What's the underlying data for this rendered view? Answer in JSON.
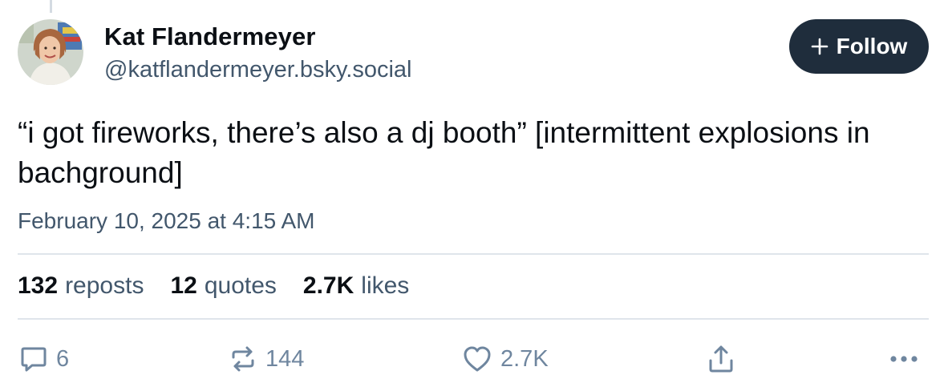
{
  "author": {
    "name": "Kat Flandermeyer",
    "handle": "@katflandermeyer.bsky.social",
    "avatar_alt": "profile photo"
  },
  "follow_button": {
    "icon": "plus-icon",
    "label": "Follow"
  },
  "post": {
    "text": "“i got fireworks, there’s also a dj booth” [intermittent explosions in bachground]",
    "timestamp": "February 10, 2025 at 4:15 AM"
  },
  "stats": [
    {
      "count": "132",
      "label": "reposts"
    },
    {
      "count": "12",
      "label": "quotes"
    },
    {
      "count": "2.7K",
      "label": "likes"
    }
  ],
  "actions": {
    "reply": {
      "icon": "reply-bubble-icon",
      "count": "6"
    },
    "repost": {
      "icon": "repost-icon",
      "count": "144"
    },
    "like": {
      "icon": "heart-icon",
      "count": "2.7K"
    },
    "share": {
      "icon": "share-icon"
    },
    "more": {
      "icon": "more-dots-icon"
    }
  },
  "colors": {
    "primary_text": "#0b0f14",
    "secondary_text": "#42576c",
    "action_icon": "#6f869f",
    "follow_button_bg": "#1f2d3c",
    "divider": "#dfe5eb"
  }
}
